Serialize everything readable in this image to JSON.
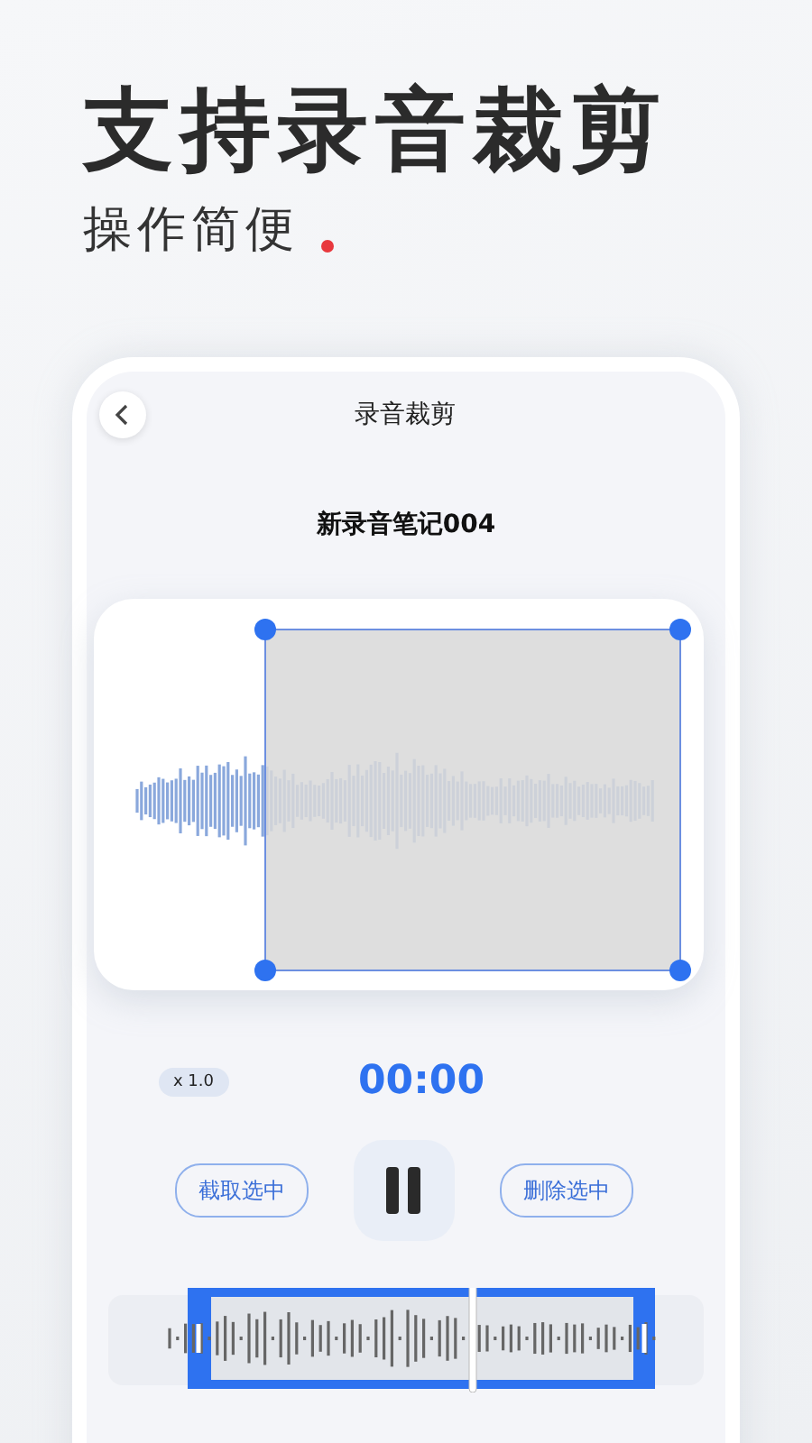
{
  "headline": "支持录音裁剪",
  "subtitle": "操作简便",
  "screen": {
    "title": "录音裁剪",
    "file_name": "新录音笔记004",
    "speed": "x 1.0",
    "time": "00:00",
    "playing": true,
    "buttons": [
      {
        "label": "截取选中"
      },
      {
        "label": "删除选中"
      }
    ]
  }
}
